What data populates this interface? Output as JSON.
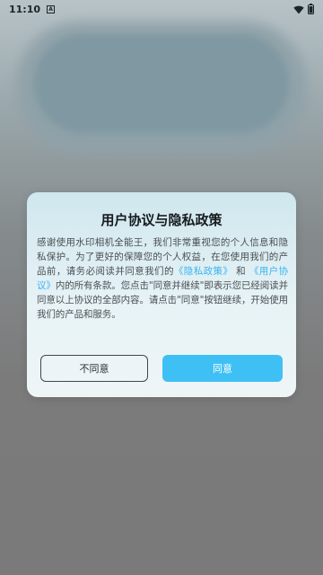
{
  "status_bar": {
    "time": "11:10",
    "notification_icon": "A",
    "icons": [
      "wifi-icon",
      "battery-icon"
    ]
  },
  "dialog": {
    "title": "用户协议与隐私政策",
    "body_part1": "感谢使用水印相机全能王，我们非常重视您的个人信息和隐私保护。为了更好的保障您的个人权益，在您使用我们的产品前，请务必阅读并同意我们的",
    "privacy_link": "《隐私政策》",
    "and_text": " 和 ",
    "agreement_link": "《用户协议》",
    "body_part2": "内的所有条款。您点击\"同意并继续\"即表示您已经阅读并同意以上协议的全部内容。请点击\"同意\"按钮继续，开始使用我们的产品和服务。",
    "disagree_label": "不同意",
    "agree_label": "同意"
  },
  "colors": {
    "accent": "#3ec0f5",
    "link": "#38b4ef",
    "overlay": "#7a7a7a"
  }
}
